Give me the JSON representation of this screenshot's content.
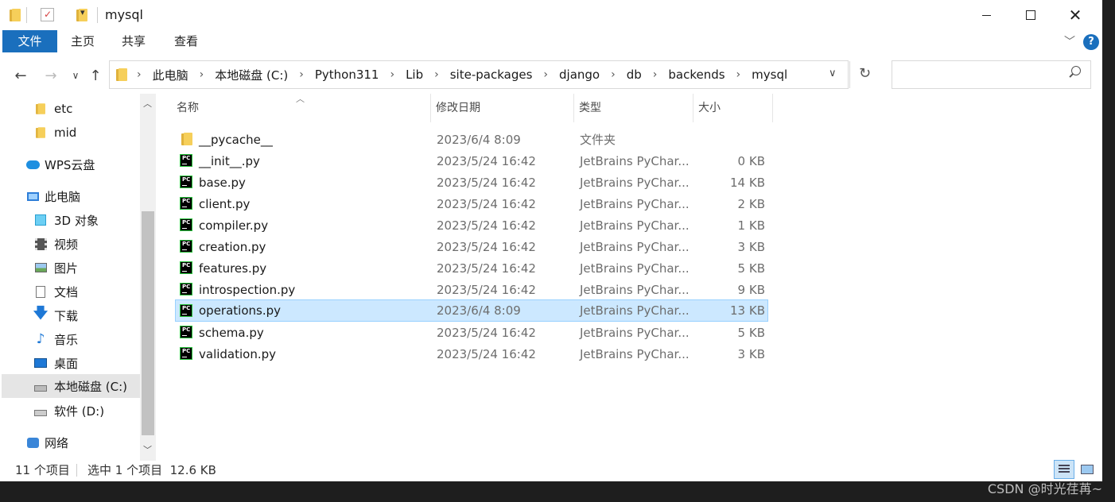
{
  "window": {
    "title": "mysql"
  },
  "ribbon": {
    "tabs": [
      {
        "label": "文件",
        "active": true
      },
      {
        "label": "主页"
      },
      {
        "label": "共享"
      },
      {
        "label": "查看"
      }
    ]
  },
  "address": {
    "crumbs": [
      "此电脑",
      "本地磁盘 (C:)",
      "Python311",
      "Lib",
      "site-packages",
      "django",
      "db",
      "backends",
      "mysql"
    ]
  },
  "search": {
    "placeholder": ""
  },
  "nav": {
    "items": [
      {
        "label": "etc",
        "icon": "folder-icon"
      },
      {
        "label": "mid",
        "icon": "folder-icon"
      },
      {
        "label": "WPS云盘",
        "icon": "cloud-icon"
      },
      {
        "label": "此电脑",
        "icon": "computer-icon"
      },
      {
        "label": "3D 对象",
        "icon": "3d-objects-icon"
      },
      {
        "label": "视频",
        "icon": "video-icon"
      },
      {
        "label": "图片",
        "icon": "pictures-icon"
      },
      {
        "label": "文档",
        "icon": "documents-icon"
      },
      {
        "label": "下载",
        "icon": "download-icon"
      },
      {
        "label": "音乐",
        "icon": "music-icon"
      },
      {
        "label": "桌面",
        "icon": "desktop-icon"
      },
      {
        "label": "本地磁盘 (C:)",
        "icon": "drive-c-icon",
        "selected": true
      },
      {
        "label": "软件 (D:)",
        "icon": "drive-d-icon"
      },
      {
        "label": "网络",
        "icon": "network-icon"
      }
    ]
  },
  "columns": {
    "name": "名称",
    "date": "修改日期",
    "type": "类型",
    "size": "大小"
  },
  "files": [
    {
      "name": "__pycache__",
      "date": "2023/6/4 8:09",
      "type": "文件夹",
      "size": "",
      "icon": "folder-icon"
    },
    {
      "name": "__init__.py",
      "date": "2023/5/24 16:42",
      "type": "JetBrains PyChar...",
      "size": "0 KB",
      "icon": "pycharm-file-icon"
    },
    {
      "name": "base.py",
      "date": "2023/5/24 16:42",
      "type": "JetBrains PyChar...",
      "size": "14 KB",
      "icon": "pycharm-file-icon"
    },
    {
      "name": "client.py",
      "date": "2023/5/24 16:42",
      "type": "JetBrains PyChar...",
      "size": "2 KB",
      "icon": "pycharm-file-icon"
    },
    {
      "name": "compiler.py",
      "date": "2023/5/24 16:42",
      "type": "JetBrains PyChar...",
      "size": "1 KB",
      "icon": "pycharm-file-icon"
    },
    {
      "name": "creation.py",
      "date": "2023/5/24 16:42",
      "type": "JetBrains PyChar...",
      "size": "3 KB",
      "icon": "pycharm-file-icon"
    },
    {
      "name": "features.py",
      "date": "2023/5/24 16:42",
      "type": "JetBrains PyChar...",
      "size": "5 KB",
      "icon": "pycharm-file-icon"
    },
    {
      "name": "introspection.py",
      "date": "2023/5/24 16:42",
      "type": "JetBrains PyChar...",
      "size": "9 KB",
      "icon": "pycharm-file-icon"
    },
    {
      "name": "operations.py",
      "date": "2023/6/4 8:09",
      "type": "JetBrains PyChar...",
      "size": "13 KB",
      "icon": "pycharm-file-icon",
      "selected": true
    },
    {
      "name": "schema.py",
      "date": "2023/5/24 16:42",
      "type": "JetBrains PyChar...",
      "size": "5 KB",
      "icon": "pycharm-file-icon"
    },
    {
      "name": "validation.py",
      "date": "2023/5/24 16:42",
      "type": "JetBrains PyChar...",
      "size": "3 KB",
      "icon": "pycharm-file-icon"
    }
  ],
  "status": {
    "count": "11 个项目",
    "selection": "选中 1 个项目  12.6 KB"
  },
  "watermark": "CSDN @时光荏苒~",
  "colors": {
    "accent": "#1a6fbd",
    "selection": "#cce8ff"
  }
}
